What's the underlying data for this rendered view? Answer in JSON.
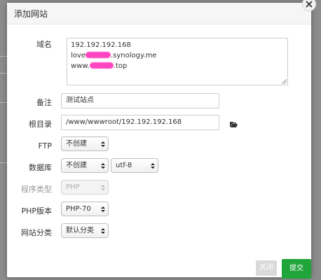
{
  "dialog": {
    "title": "添加网站"
  },
  "form": {
    "domain": {
      "label": "域名",
      "lines": [
        {
          "before": "192.192.192.168",
          "after": ""
        },
        {
          "before": "love",
          "after": ".synology.me"
        },
        {
          "before": "www.",
          "after": ".top"
        }
      ]
    },
    "note": {
      "label": "备注",
      "value": "测试站点"
    },
    "root": {
      "label": "根目录",
      "value": "/www/wwwroot/192.192.192.168"
    },
    "ftp": {
      "label": "FTP",
      "value": "不创建"
    },
    "database": {
      "label": "数据库",
      "value": "不创建",
      "charset": "utf-8"
    },
    "program_type": {
      "label": "程序类型",
      "value": "PHP"
    },
    "php_version": {
      "label": "PHP版本",
      "value": "PHP-70"
    },
    "category": {
      "label": "网站分类",
      "value": "默认分类"
    }
  },
  "buttons": {
    "close": "关闭",
    "submit": "提交"
  },
  "colors": {
    "submit": "#20a53a",
    "redaction": "#ff44c0"
  },
  "icons": {
    "close": "close-icon",
    "folder": "folder-open-icon",
    "caret": "select-caret-icon"
  }
}
